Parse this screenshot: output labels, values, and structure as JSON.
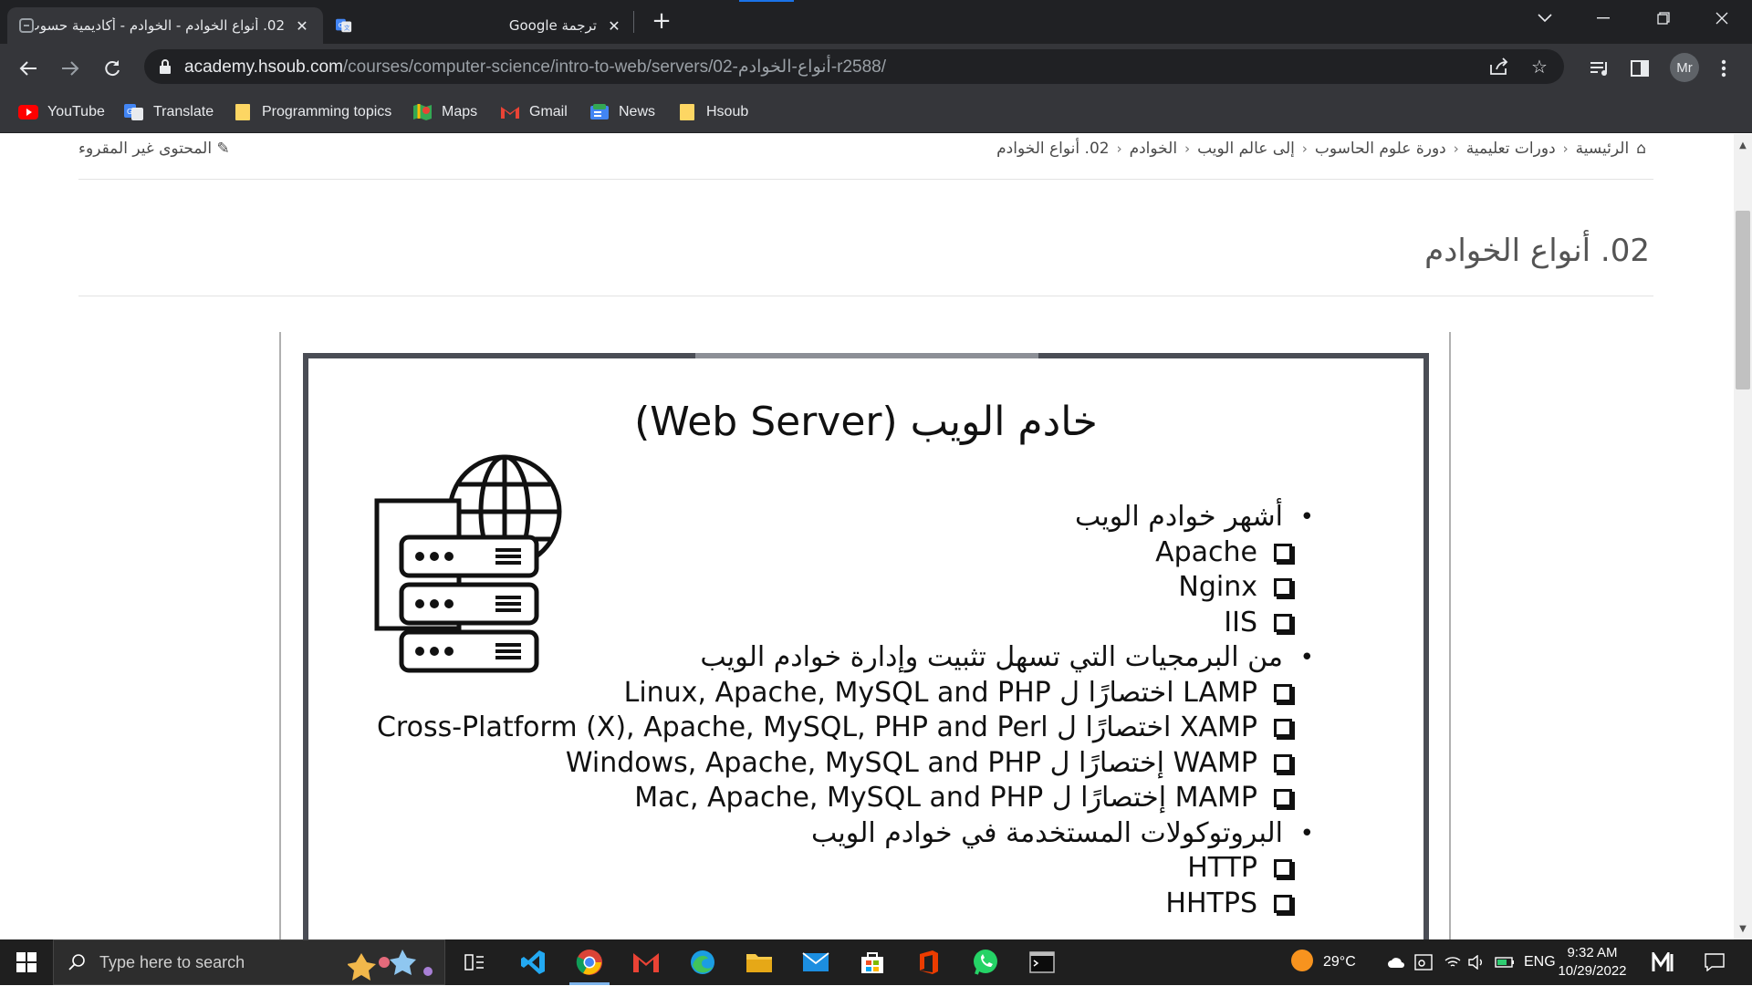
{
  "browser": {
    "tabs": [
      {
        "title": "02. أنواع الخوادم - الخوادم - أكاديمية حسوب",
        "active": true
      },
      {
        "title": "ترجمة Google",
        "active": false
      }
    ],
    "url_domain": "academy.hsoub.com",
    "url_path": "/courses/computer-science/intro-to-web/servers/02-أنواع-الخوادم-r2588/",
    "profile_initials": "Mr",
    "bookmarks": [
      {
        "label": "YouTube",
        "icon": "youtube-icon"
      },
      {
        "label": "Translate",
        "icon": "google-translate-icon"
      },
      {
        "label": "Programming topics",
        "icon": "folder-icon"
      },
      {
        "label": "Maps",
        "icon": "google-maps-icon"
      },
      {
        "label": "Gmail",
        "icon": "gmail-icon"
      },
      {
        "label": "News",
        "icon": "google-news-icon"
      },
      {
        "label": "Hsoub",
        "icon": "folder-icon"
      }
    ]
  },
  "page": {
    "breadcrumb": [
      "الرئيسية",
      "دورات تعليمية",
      "دورة علوم الحاسوب",
      "إلى عالم الويب",
      "الخوادم",
      "02. أنواع الخوادم"
    ],
    "unread_label": "المحتوى غير المقروء",
    "title": "02. أنواع الخوادم"
  },
  "slide": {
    "title": "خادم الويب (Web Server)",
    "sections": [
      {
        "heading": "أشهر خوادم الويب",
        "items": [
          "Apache",
          "Nginx",
          "IIS"
        ]
      },
      {
        "heading": "من البرمجيات التي تسهل تثبيت وإدارة خوادم الويب",
        "items": [
          "LAMP اختصارًا ل Linux, Apache, MySQL and PHP",
          "XAMP اختصارًا ل Cross-Platform (X), Apache, MySQL, PHP and Perl",
          "WAMP إختصارًا ل Windows, Apache, MySQL and PHP",
          "MAMP إختصارًا ل Mac, Apache, MySQL  and PHP"
        ]
      },
      {
        "heading": "البروتوكولات المستخدمة في خوادم الويب",
        "items": [
          "HTTP",
          "HHTPS"
        ]
      }
    ]
  },
  "taskbar": {
    "search_placeholder": "Type here to search",
    "weather": "29°C",
    "language": "ENG",
    "time": "9:32 AM",
    "date": "10/29/2022"
  },
  "colors": {
    "chrome_dark": "#202124",
    "chrome_toolbar": "#35363a",
    "slide_border": "#4a4d55"
  }
}
